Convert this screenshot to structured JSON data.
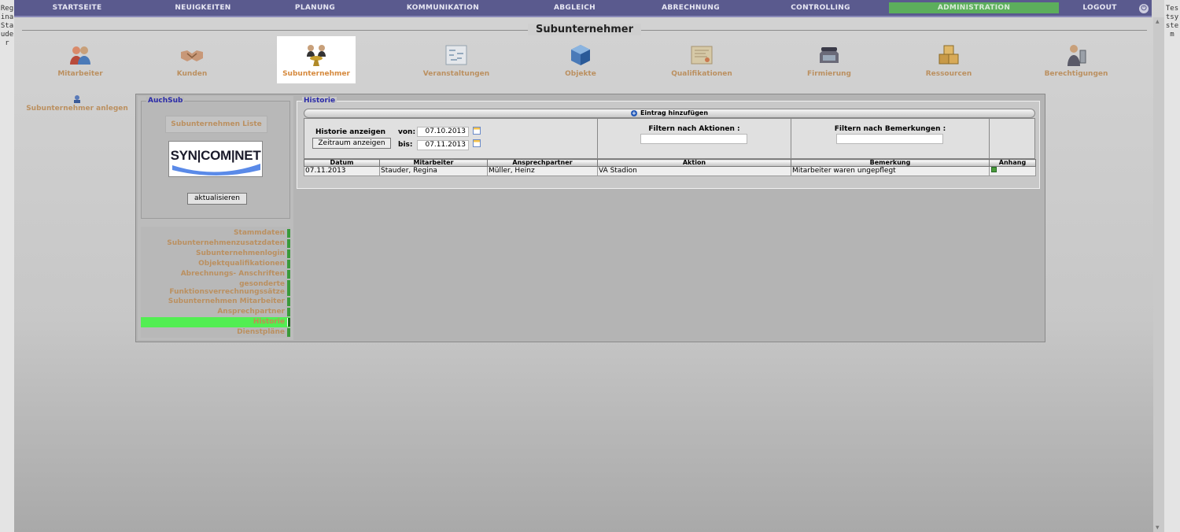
{
  "sidebar_left": {
    "user_letters": "Regina Stauder"
  },
  "sidebar_right": {
    "env_letters": "Testsystem"
  },
  "topnav": {
    "items": [
      "STARTSEITE",
      "NEUIGKEITEN",
      "PLANUNG",
      "KOMMUNIKATION",
      "ABGLEICH",
      "ABRECHNUNG",
      "CONTROLLING",
      "ADMINISTRATION",
      "LOGOUT"
    ],
    "active": "ADMINISTRATION"
  },
  "page": {
    "title": "Subunternehmer"
  },
  "modules": [
    {
      "label": "Mitarbeiter",
      "icon": "employees-icon"
    },
    {
      "label": "Kunden",
      "icon": "handshake-icon"
    },
    {
      "label": "Subunternehmer",
      "icon": "subcontractor-icon"
    },
    {
      "label": "Veranstaltungen",
      "icon": "event-plan-icon"
    },
    {
      "label": "Objekte",
      "icon": "cube-icon"
    },
    {
      "label": "Qualifikationen",
      "icon": "certificate-icon"
    },
    {
      "label": "Firmierung",
      "icon": "phone-icon"
    },
    {
      "label": "Ressourcen",
      "icon": "boxes-icon"
    },
    {
      "label": "Berechtigungen",
      "icon": "permissions-icon"
    }
  ],
  "create_link": {
    "label": "Subunternehmer anlegen"
  },
  "auchsub": {
    "legend": "AuchSub",
    "list_button": "Subunternehmen Liste",
    "logo_text": "SYN|COM|NET",
    "refresh_button": "aktualisieren"
  },
  "side_nav": [
    "Stammdaten",
    "Subunternehmenzusatzdaten",
    "Subunternehmenlogin",
    "Objektqualifikationen",
    "Abrechnungs- Anschriften",
    "gesonderte Funktionsverrechnungssätze",
    "Subunternehmen Mitarbeiter",
    "Ansprechpartner",
    "Historie",
    "Dienstpläne"
  ],
  "side_nav_active": "Historie",
  "historie": {
    "legend": "Historie",
    "add_button": "Eintrag hinzufügen",
    "show_label": "Historie anzeigen",
    "from_label": "von:",
    "to_label": "bis:",
    "from_value": "07.10.2013",
    "to_value": "07.11.2013",
    "range_button": "Zeitraum anzeigen",
    "filter_actions_label": "Filtern nach Aktionen :",
    "filter_notes_label": "Filtern nach Bemerkungen :",
    "filter_actions_value": "",
    "filter_notes_value": "",
    "columns": [
      "Datum",
      "Mitarbeiter",
      "Ansprechpartner",
      "Aktion",
      "Bemerkung",
      "Anhang"
    ],
    "rows": [
      [
        "07.11.2013",
        "Stauder, Regina",
        "Müller, Heinz",
        "VA Stadion",
        "Mitarbeiter waren ungepflegt",
        ""
      ]
    ]
  },
  "colors": {
    "nav_bg": "#5a5a8e",
    "active_green": "#52ee52",
    "accent_orange": "#bb9060",
    "legend_blue": "#2a2aa8"
  }
}
